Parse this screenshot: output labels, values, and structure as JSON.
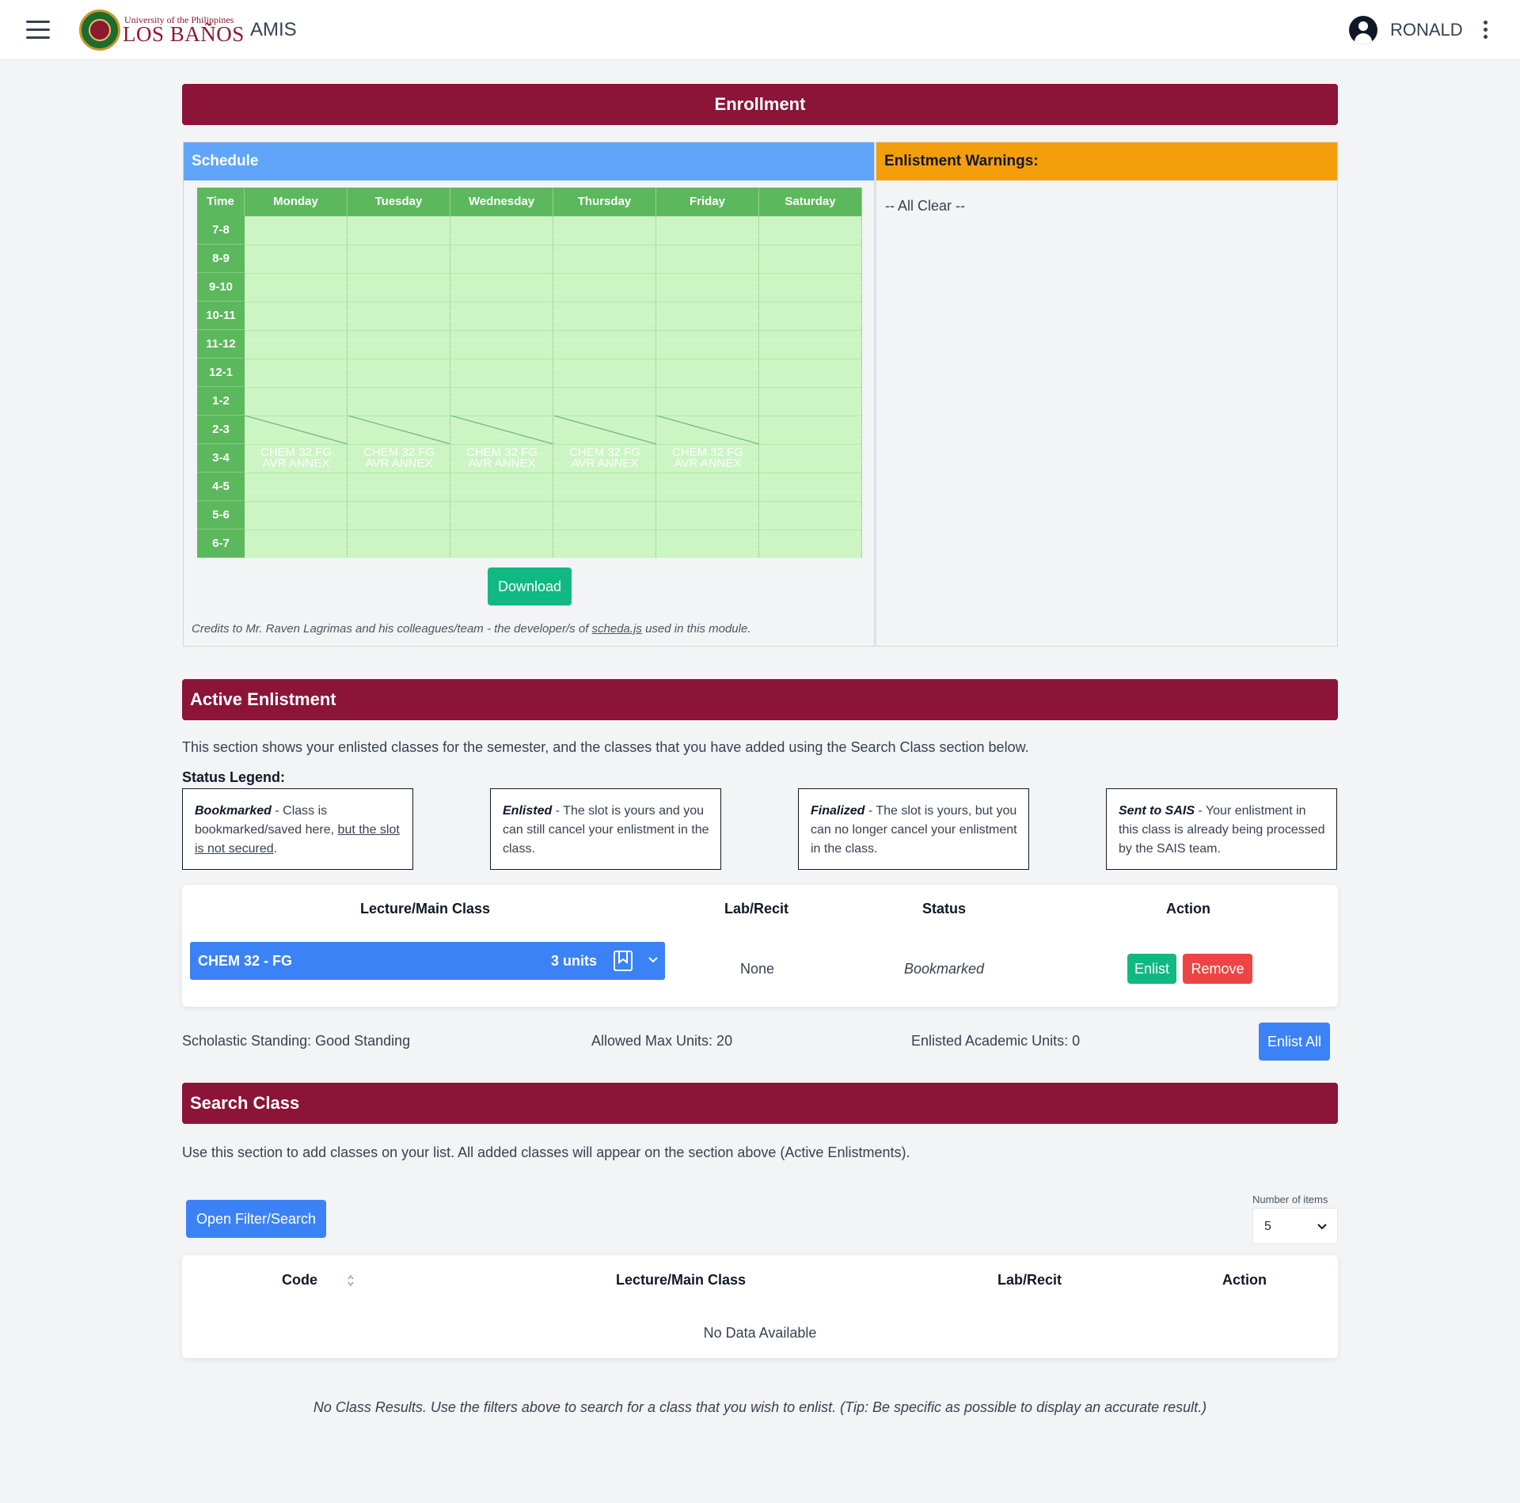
{
  "header": {
    "logo_small": "University of the Philippines",
    "logo_big": "LOS BAÑOS",
    "app_name": "AMIS",
    "username": "RONALD"
  },
  "enrollment": {
    "title": "Enrollment",
    "schedule": {
      "title": "Schedule",
      "time_header": "Time",
      "days": [
        "Monday",
        "Tuesday",
        "Wednesday",
        "Thursday",
        "Friday",
        "Saturday"
      ],
      "times": [
        "7-8",
        "8-9",
        "9-10",
        "10-11",
        "11-12",
        "12-1",
        "1-2",
        "2-3",
        "3-4",
        "4-5",
        "5-6",
        "6-7"
      ],
      "class_label_line1": "CHEM 32 FG",
      "class_label_line2": "AVR ANNEX",
      "download_label": "Download",
      "credits_prefix": "Credits to Mr. Raven Lagrimas and his colleagues/team - the developer/s of ",
      "credits_link": "scheda.js",
      "credits_suffix": " used in this module."
    },
    "warnings": {
      "title": "Enlistment Warnings:",
      "text": "-- All Clear --"
    }
  },
  "active": {
    "title": "Active Enlistment",
    "description": "This section shows your enlisted classes for the semester, and the classes that you have added using the Search Class section below.",
    "legend_title": "Status Legend:",
    "legend": [
      {
        "term": "Bookmarked",
        "text": " - Class is bookmarked/saved here, ",
        "underlined": "but the slot is not secured",
        "tail": "."
      },
      {
        "term": "Enlisted",
        "text": " - The slot is yours and you can still cancel your enlistment in the class.",
        "underlined": "",
        "tail": ""
      },
      {
        "term": "Finalized",
        "text": " - The slot is yours, but you can no longer cancel your enlistment in the class.",
        "underlined": "",
        "tail": ""
      },
      {
        "term": "Sent to SAIS",
        "text": " - Your enlistment in this class is already being processed by the SAIS team.",
        "underlined": "",
        "tail": ""
      }
    ],
    "table": {
      "headers": {
        "main": "Lecture/Main Class",
        "lab": "Lab/Recit",
        "status": "Status",
        "action": "Action"
      },
      "row": {
        "class_name": "CHEM 32 - FG",
        "units": "3 units",
        "lab": "None",
        "status": "Bookmarked",
        "enlist_label": "Enlist",
        "remove_label": "Remove"
      }
    },
    "standing": "Scholastic Standing: Good Standing",
    "max_units": "Allowed Max Units: 20",
    "enlisted_units": "Enlisted Academic Units: 0",
    "enlist_all_label": "Enlist All"
  },
  "search": {
    "title": "Search Class",
    "description": "Use this section to add classes on your list. All added classes will appear on the section above (Active Enlistments).",
    "open_filter_label": "Open Filter/Search",
    "items_label": "Number of items",
    "items_value": "5",
    "headers": {
      "code": "Code",
      "main": "Lecture/Main Class",
      "lab": "Lab/Recit",
      "action": "Action"
    },
    "no_data": "No Data Available",
    "no_results": "No Class Results. Use the filters above to search for a class that you wish to enlist. (Tip: Be specific as possible to display an accurate result.)"
  },
  "colors": {
    "brand": "#8b1438",
    "schedule_header": "#60a5fa",
    "warning_header": "#f59e0b",
    "grid_green": "#5cb85c",
    "primary_blue": "#3b82f6",
    "success_green": "#10b981",
    "danger_red": "#ef4444"
  }
}
